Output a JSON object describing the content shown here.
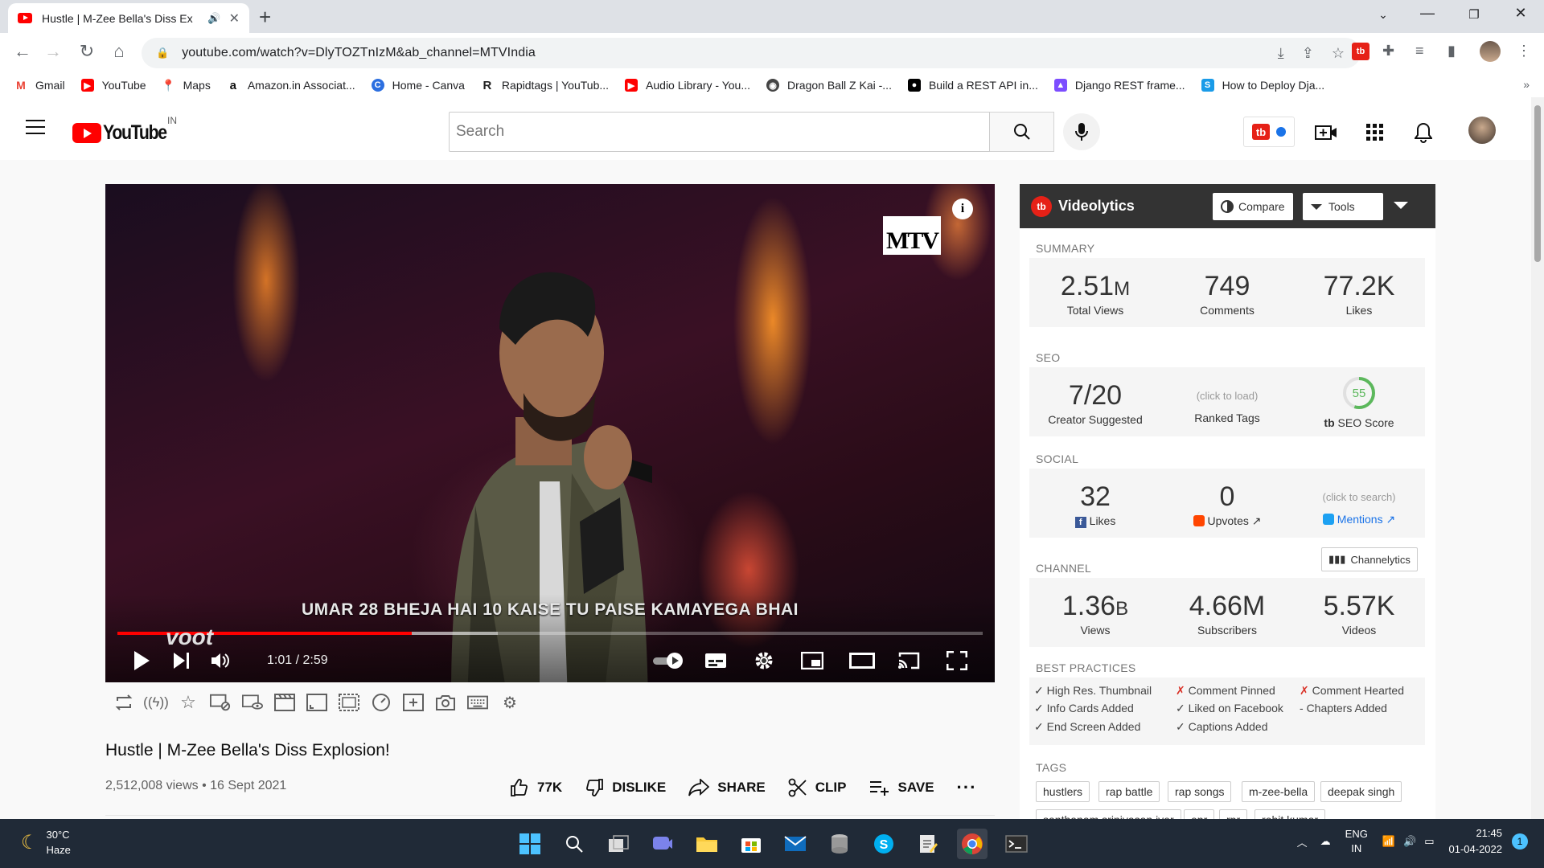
{
  "browser": {
    "tab_title": "Hustle | M-Zee Bella's Diss Ex",
    "url": "youtube.com/watch?v=DlyTOZTnIzM&ab_channel=MTVIndia",
    "bookmarks": [
      {
        "label": "Gmail",
        "icon": "gmail-icon",
        "color": "#ea4335"
      },
      {
        "label": "YouTube",
        "icon": "youtube-icon",
        "color": "#ff0000"
      },
      {
        "label": "Maps",
        "icon": "maps-icon",
        "color": "#34a853"
      },
      {
        "label": "Amazon.in Associat...",
        "icon": "amazon-icon",
        "color": "#111111"
      },
      {
        "label": "Home - Canva",
        "icon": "canva-icon",
        "color": "#2c6fe0"
      },
      {
        "label": "Rapidtags | YouTub...",
        "icon": "rapidtags-icon",
        "color": "#222222"
      },
      {
        "label": "Audio Library - You...",
        "icon": "youtube-icon",
        "color": "#ff0000"
      },
      {
        "label": "Dragon Ball Z Kai -...",
        "icon": "dragonball-icon",
        "color": "#444444"
      },
      {
        "label": "Build a REST API in...",
        "icon": "dev-icon",
        "color": "#000000"
      },
      {
        "label": "Django REST frame...",
        "icon": "django-icon",
        "color": "#7c4dff"
      },
      {
        "label": "How to Deploy Dja...",
        "icon": "deploy-icon",
        "color": "#1a9be8"
      }
    ]
  },
  "masthead": {
    "logo_text": "YouTube",
    "country": "IN",
    "search_placeholder": "Search"
  },
  "player": {
    "caption": "UMAR 28 BHEJA HAI 10 KAISE TU PAISE KAMAYEGA BHAI",
    "time": "1:01 / 2:59",
    "progress": 0.34,
    "buffered": 0.44,
    "watermark": "voot",
    "channel_logo": "MTV"
  },
  "video": {
    "title": "Hustle | M-Zee Bella's Diss Explosion!",
    "meta": "2,512,008 views • 16 Sept 2021",
    "likes": "77K",
    "dislike_label": "DISLIKE",
    "share_label": "SHARE",
    "clip_label": "CLIP",
    "save_label": "SAVE"
  },
  "videolytics": {
    "title": "Videolytics",
    "compare_label": "Compare",
    "tools_label": "Tools",
    "summary_label": "SUMMARY",
    "views_num": "2.51",
    "views_unit": "M",
    "views_label": "Total Views",
    "comments": "749",
    "comments_label": "Comments",
    "likes": "77.2K",
    "likes_label": "Likes",
    "seo_label": "SEO",
    "creator_suggested": "7/20",
    "creator_suggested_label": "Creator Suggested",
    "ranked_tags_hint": "(click to load)",
    "ranked_tags_label": "Ranked Tags",
    "seo_score": "55",
    "seo_score_label": "SEO Score",
    "social_label": "SOCIAL",
    "fb_likes": "32",
    "fb_likes_label": "Likes",
    "upvotes": "0",
    "upvotes_label": "Upvotes",
    "mentions_hint": "(click to search)",
    "mentions_label": "Mentions",
    "channel_label": "CHANNEL",
    "channelytics_label": "Channelytics",
    "ch_views_num": "1.36",
    "ch_views_unit": "B",
    "ch_views_label": "Views",
    "subscribers": "4.66M",
    "subscribers_label": "Subscribers",
    "videos": "5.57K",
    "videos_label": "Videos",
    "best_practices_label": "BEST PRACTICES",
    "best_practices": [
      {
        "mark": "✓",
        "text": "High Res. Thumbnail",
        "ok": true
      },
      {
        "mark": "✗",
        "text": "Comment Pinned",
        "ok": false
      },
      {
        "mark": "✗",
        "text": "Comment Hearted",
        "ok": false
      },
      {
        "mark": "✓",
        "text": "Info Cards Added",
        "ok": true
      },
      {
        "mark": "✓",
        "text": "Liked on Facebook",
        "ok": true
      },
      {
        "mark": "-",
        "text": "Chapters Added",
        "ok": null
      },
      {
        "mark": "✓",
        "text": "End Screen Added",
        "ok": true
      },
      {
        "mark": "✓",
        "text": "Captions Added",
        "ok": true
      }
    ],
    "tags_label": "TAGS",
    "tags": [
      "hustlers",
      "rap battle",
      "rap songs",
      "m-zee-bella",
      "deepak singh",
      "santhanam srinivasan iyer",
      "epr",
      "rpr",
      "rohit kumar"
    ]
  },
  "taskbar": {
    "temperature": "30°C",
    "weather": "Haze",
    "lang": "ENG",
    "region": "IN",
    "time": "21:45",
    "date": "01-04-2022",
    "notification_count": "1"
  }
}
